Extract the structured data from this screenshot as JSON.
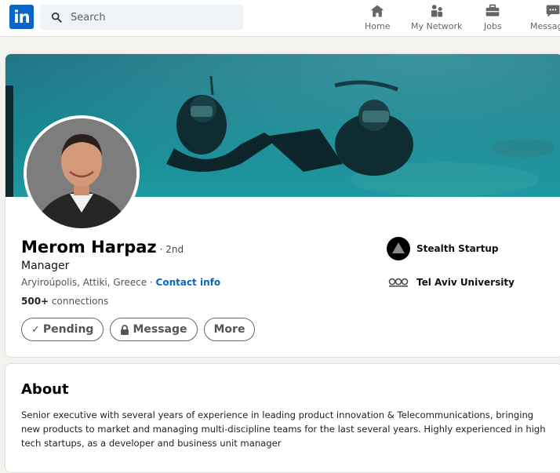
{
  "nav": {
    "search_placeholder": "Search",
    "items": [
      {
        "label": "Home",
        "icon": "home-icon"
      },
      {
        "label": "My Network",
        "icon": "network-icon"
      },
      {
        "label": "Jobs",
        "icon": "briefcase-icon"
      },
      {
        "label": "Messaging",
        "icon": "messaging-icon"
      }
    ]
  },
  "profile": {
    "name": "Merom Harpaz",
    "degree": "· 2nd",
    "headline": "Manager",
    "location": "Aryiroúpolis, Attiki, Greece · ",
    "contact_info": "Contact info",
    "connections_count": "500+",
    "connections_label": " connections",
    "actions": {
      "pending": "Pending",
      "message": "Message",
      "more": "More"
    },
    "orgs": [
      {
        "name": "Stealth Startup",
        "icon": "stealth-logo"
      },
      {
        "name": "Tel Aviv University",
        "icon": "university-logo"
      }
    ]
  },
  "about": {
    "title": "About",
    "text": "Senior executive with several years of experience in leading product innovation & Telecommunications, bringing new products to market and managing multi-discipline teams for the last several years. Highly experienced in high tech startups, as a developer and business unit manager"
  },
  "colors": {
    "brand": "#0a66c2",
    "background": "#f3f2ef"
  }
}
